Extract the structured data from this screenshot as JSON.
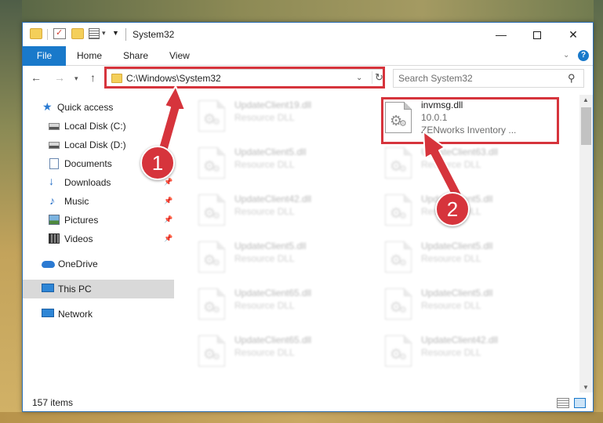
{
  "window": {
    "title": "System32",
    "minimize": "—",
    "maximize": "",
    "close": "✕"
  },
  "ribbon": {
    "file": "File",
    "home": "Home",
    "share": "Share",
    "view": "View",
    "help": "?"
  },
  "address": {
    "path": "C:\\Windows\\System32",
    "search_placeholder": "Search System32"
  },
  "sidebar": {
    "items": [
      {
        "label": "Quick access",
        "icon": "star-icon"
      },
      {
        "label": "Local Disk (C:)",
        "icon": "drive-icon"
      },
      {
        "label": "Local Disk (D:)",
        "icon": "drive-icon"
      },
      {
        "label": "Documents",
        "icon": "document-icon"
      },
      {
        "label": "Downloads",
        "icon": "download-icon"
      },
      {
        "label": "Music",
        "icon": "music-icon"
      },
      {
        "label": "Pictures",
        "icon": "pictures-icon"
      },
      {
        "label": "Videos",
        "icon": "videos-icon"
      },
      {
        "label": "OneDrive",
        "icon": "cloud-icon"
      },
      {
        "label": "This PC",
        "icon": "computer-icon"
      },
      {
        "label": "Network",
        "icon": "network-icon"
      }
    ]
  },
  "files": {
    "highlighted": {
      "name": "invmsg.dll",
      "version": "10.0.1",
      "description": "ZENworks Inventory ..."
    },
    "left_column": [
      {
        "name": "UpdateClient19.dll",
        "type": "Resource DLL"
      },
      {
        "name": "UpdateClient5.dll",
        "type": "Resource DLL"
      },
      {
        "name": "UpdateClient42.dll",
        "type": "Resource DLL"
      },
      {
        "name": "UpdateClient5.dll",
        "type": "Resource DLL"
      },
      {
        "name": "UpdateClient65.dll",
        "type": "Resource DLL"
      },
      {
        "name": "UpdateClient65.dll",
        "type": "Resource DLL"
      }
    ],
    "right_column": [
      {
        "name": "UpdateClient63.dll",
        "type": "Resource DLL"
      },
      {
        "name": "UpdateClient5.dll",
        "type": "Resource DLL"
      },
      {
        "name": "UpdateClient5.dll",
        "type": "Resource DLL"
      },
      {
        "name": "UpdateClient5.dll",
        "type": "Resource DLL"
      },
      {
        "name": "UpdateClient42.dll",
        "type": "Resource DLL"
      }
    ]
  },
  "status": {
    "count": "157 items"
  },
  "annotations": {
    "step1": "1",
    "step2": "2",
    "color": "#d6343c"
  }
}
